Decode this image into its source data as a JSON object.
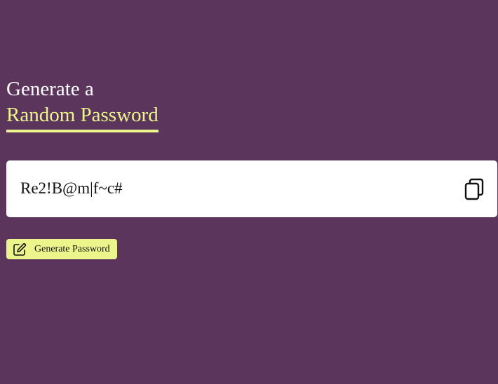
{
  "heading": {
    "line1": "Generate a",
    "line2": "Random Password"
  },
  "password": {
    "value": "Re2!B@m|f~c#",
    "copy_icon": "copy-icon"
  },
  "generate_button": {
    "label": "Generate Password",
    "icon": "edit-icon"
  },
  "colors": {
    "background": "#5b355c",
    "accent": "#ecf48c",
    "text_light": "#ffffff",
    "box": "#ffffff"
  }
}
